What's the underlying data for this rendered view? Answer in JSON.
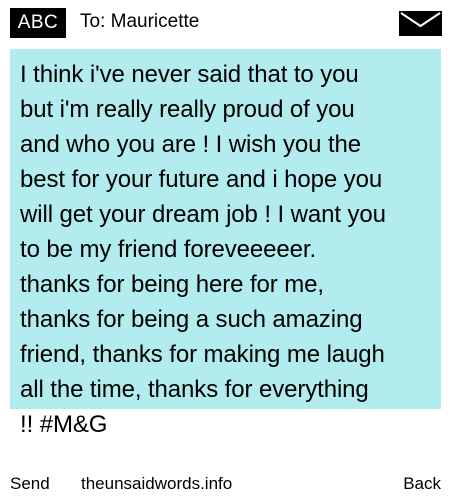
{
  "header": {
    "input_mode_label": "ABC",
    "recipient_label": "To: Mauricette",
    "mail_icon": "envelope-icon"
  },
  "message": {
    "body": "I think i've never said that to you\nbut i'm really really proud of you\nand who you are ! I wish you the\nbest for your future and i hope you\nwill get your dream job ! I want you\nto be my friend foreveeeeer.\nthanks for being here for me,\nthanks for being a such amazing\nfriend, thanks for making me laugh\nall the time, thanks for everything\n!! #M&G",
    "highlight_color": "#b2ecee"
  },
  "footer": {
    "send_label": "Send",
    "site_label": "theunsaidwords.info",
    "back_label": "Back"
  }
}
